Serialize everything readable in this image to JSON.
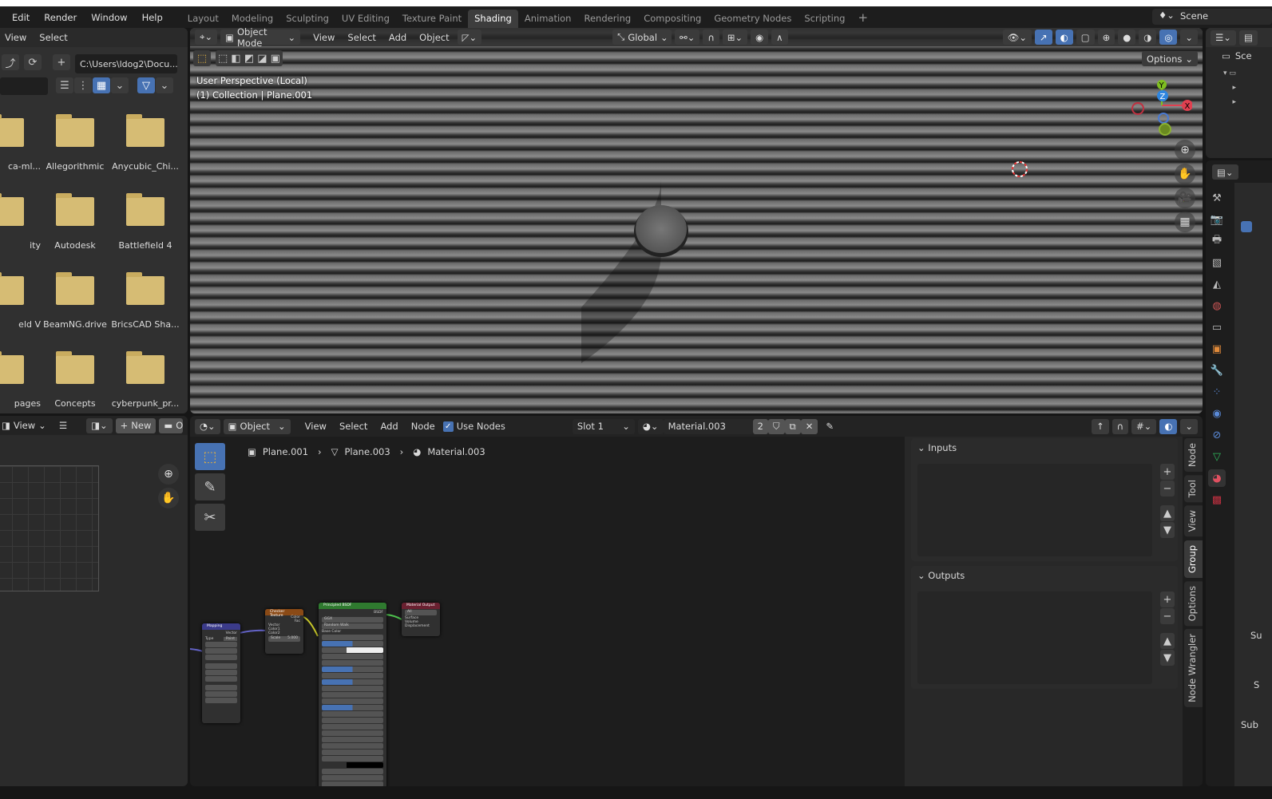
{
  "menu": [
    "Edit",
    "Render",
    "Window",
    "Help"
  ],
  "workspaces": [
    "Layout",
    "Modeling",
    "Sculpting",
    "UV Editing",
    "Texture Paint",
    "Shading",
    "Animation",
    "Rendering",
    "Compositing",
    "Geometry Nodes",
    "Scripting",
    "+"
  ],
  "active_workspace": "Shading",
  "scene": "Scene",
  "filebrowser": {
    "menu": [
      "View",
      "Select"
    ],
    "path": "C:\\Users\\ldog2\\Docu...",
    "files": [
      [
        "ca-ml...",
        "Allegorithmic",
        "Anycubic_Chi..."
      ],
      [
        "ity",
        "Autodesk",
        "Battlefield 4"
      ],
      [
        "eld V",
        "BeamNG.drive",
        "BricsCAD Sha..."
      ],
      [
        "pages",
        "Concepts",
        "cyberpunk_pr..."
      ]
    ]
  },
  "viewport": {
    "mode": "Object Mode",
    "menu": [
      "View",
      "Select",
      "Add",
      "Object"
    ],
    "orientation": "Global",
    "options": "Options",
    "info_line1": "User Perspective (Local)",
    "info_line2": "(1) Collection | Plane.001",
    "gizmo": {
      "x": "X",
      "y": "Y",
      "z": "Z"
    }
  },
  "image_editor": {
    "view": "View",
    "new": "New",
    "open": "Open"
  },
  "node_editor": {
    "type": "Object",
    "menu": [
      "View",
      "Select",
      "Add",
      "Node"
    ],
    "use_nodes": "Use Nodes",
    "slot": "Slot 1",
    "material": "Material.003",
    "users": "2",
    "breadcrumb": [
      "Plane.001",
      "Plane.003",
      "Material.003"
    ],
    "nodes": {
      "mapping": {
        "title": "Mapping",
        "type_label": "Type",
        "type": "Point",
        "out": "Vector"
      },
      "checker": {
        "title": "Checker Texture",
        "outputs": [
          "Color",
          "Fac"
        ],
        "inputs": [
          "Vector",
          "Color1",
          "Color2"
        ],
        "scale": "Scale",
        "scale_val": "5.000"
      },
      "bsdf": {
        "title": "Principled BSDF",
        "out": "BSDF",
        "dist": "GGX",
        "sss": "Random Walk",
        "base": "Base Color"
      },
      "output": {
        "title": "Material Output",
        "target": "All",
        "inputs": [
          "Surface",
          "Volume",
          "Displacement"
        ]
      }
    },
    "sidebar": {
      "inputs": "Inputs",
      "outputs": "Outputs"
    },
    "tabs": [
      "Node",
      "Tool",
      "View",
      "Group",
      "Options",
      "Node Wrangler"
    ]
  },
  "properties": {
    "labels": [
      "Su",
      "S",
      "Sub"
    ]
  },
  "outliner": {
    "scene": "Sce"
  }
}
